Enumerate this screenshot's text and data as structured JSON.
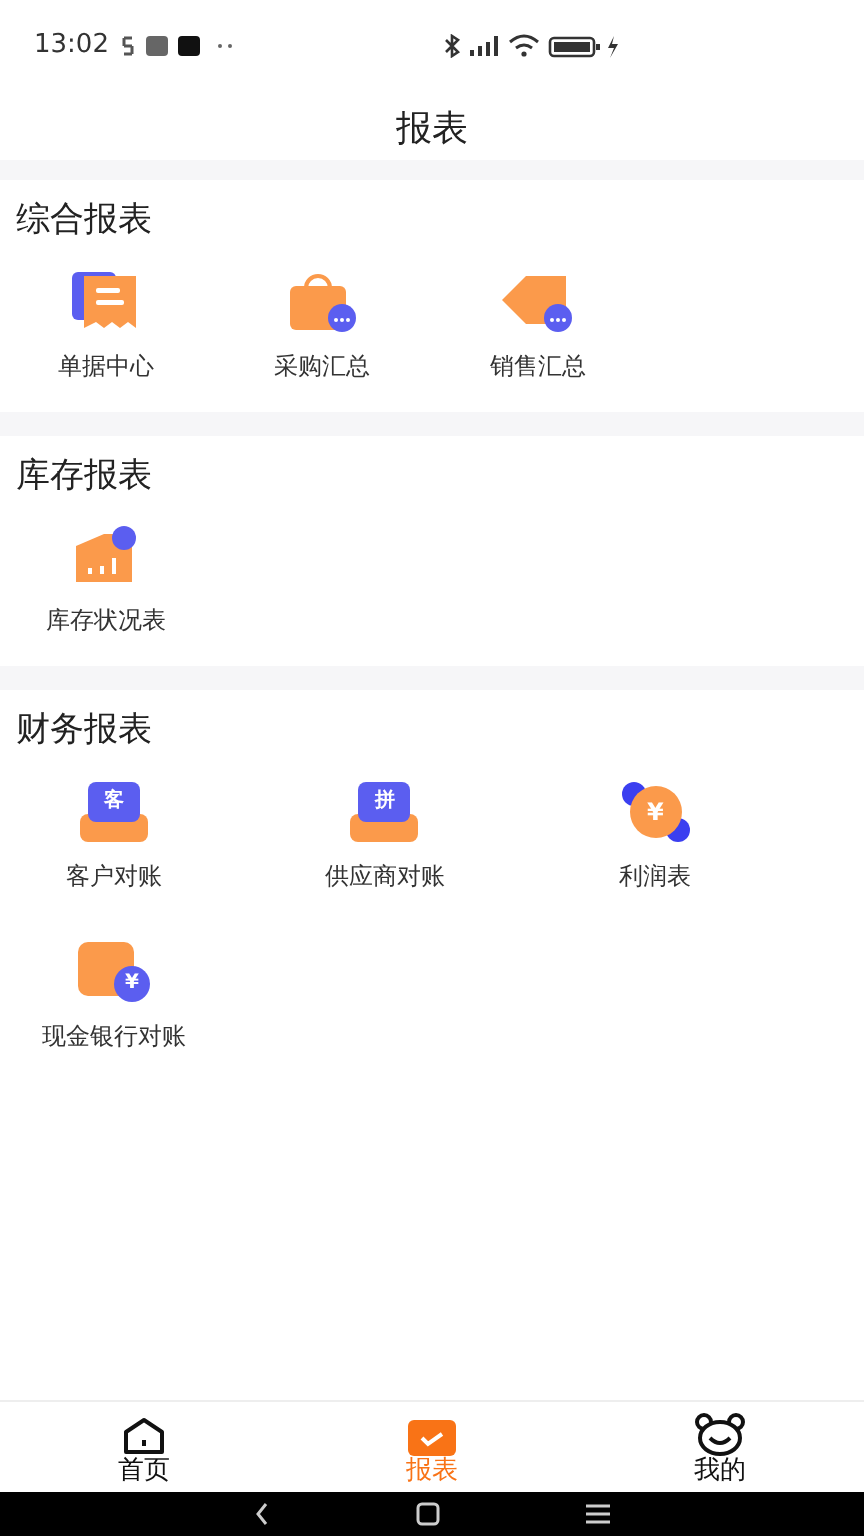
{
  "status_bar": {
    "time": "13:02"
  },
  "header": {
    "title": "报表"
  },
  "sections": [
    {
      "title": "综合报表",
      "kind": "compact",
      "items": [
        {
          "label": "单据中心",
          "kind": "receipt"
        },
        {
          "label": "采购汇总",
          "kind": "bag"
        },
        {
          "label": "销售汇总",
          "kind": "tag"
        }
      ]
    },
    {
      "title": "库存报表",
      "kind": "compact",
      "items": [
        {
          "label": "库存状况表",
          "kind": "warehouse"
        }
      ]
    },
    {
      "title": "财务报表",
      "kind": "wide",
      "items": [
        {
          "label": "客户对账",
          "kind": "envelope",
          "icon_text": "客"
        },
        {
          "label": "供应商对账",
          "kind": "envelope",
          "icon_text": "拼"
        },
        {
          "label": "利润表",
          "kind": "coin",
          "icon_text": "¥"
        },
        {
          "label": "现金银行对账",
          "kind": "wallet",
          "icon_text": "¥"
        }
      ]
    }
  ],
  "tab_bar": [
    {
      "label": "首页",
      "kind": "home",
      "selected": false
    },
    {
      "label": "报表",
      "kind": "chart",
      "selected": true
    },
    {
      "label": "我的",
      "kind": "face",
      "selected": false
    }
  ]
}
